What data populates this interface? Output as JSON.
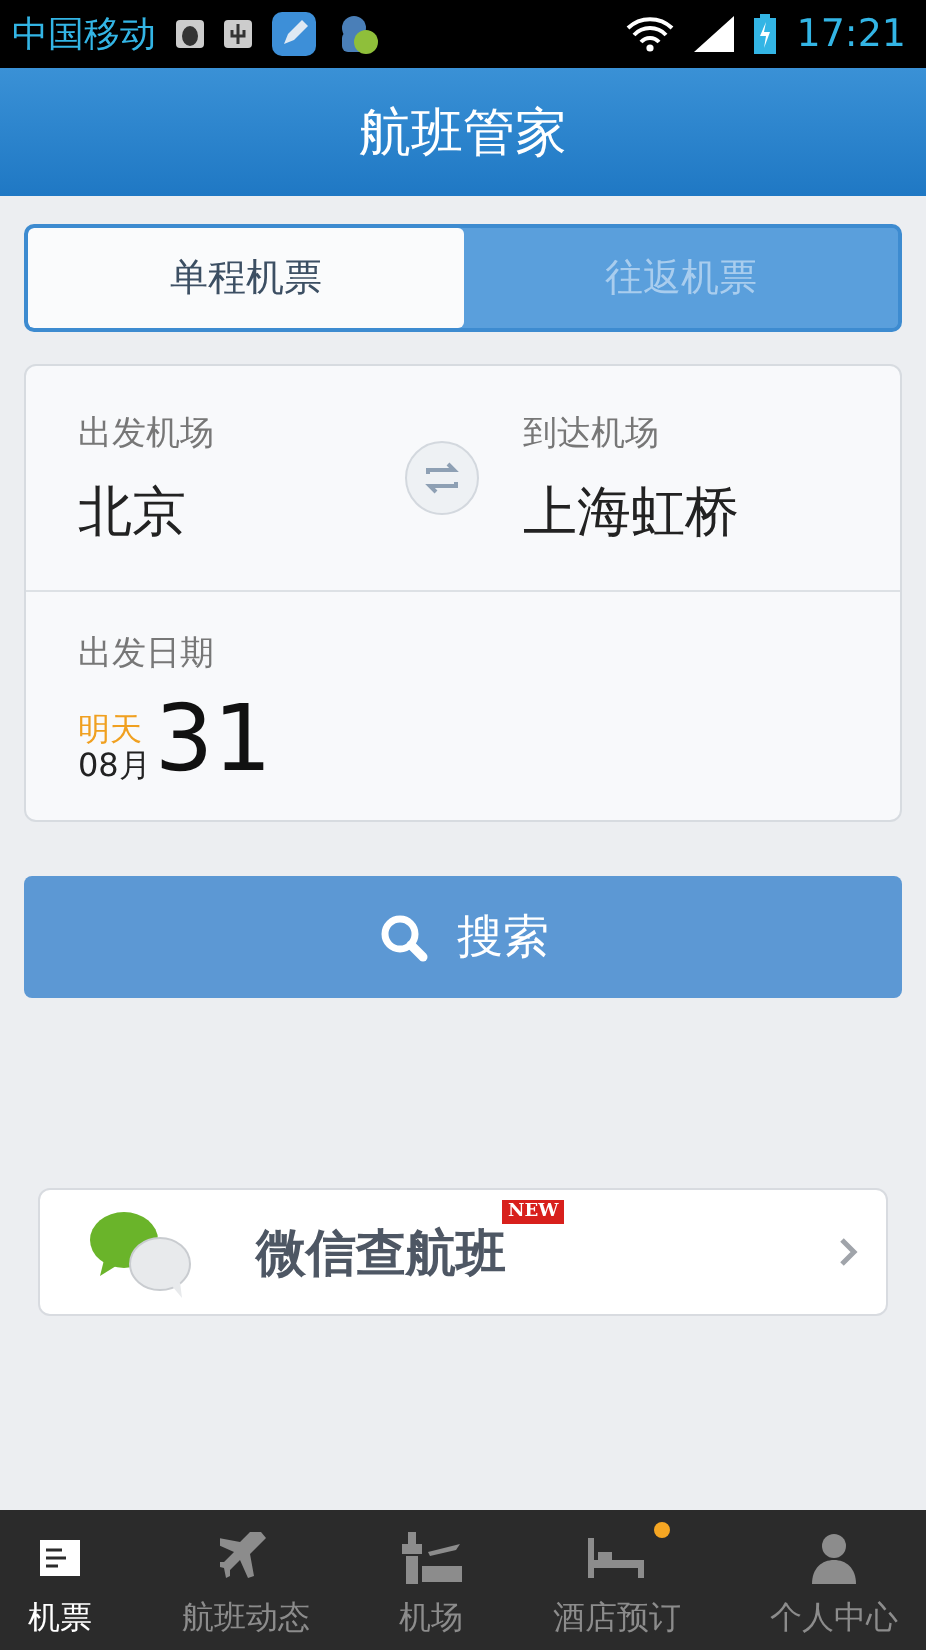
{
  "status_bar": {
    "carrier": "中国移动",
    "time": "17:21"
  },
  "header": {
    "title": "航班管家"
  },
  "trip_tabs": [
    {
      "label": "单程机票",
      "selected": true
    },
    {
      "label": "往返机票",
      "selected": false
    }
  ],
  "route": {
    "from_label": "出发机场",
    "from_value": "北京",
    "to_label": "到达机场",
    "to_value": "上海虹桥"
  },
  "date": {
    "label": "出发日期",
    "relative": "明天",
    "month": "08月",
    "day": "31"
  },
  "search_button": "搜索",
  "wechat_card": {
    "title": "微信查航班",
    "badge": "NEW"
  },
  "bottom_nav": [
    {
      "kind": "ticket",
      "label": "机票",
      "selected": true,
      "dot": false
    },
    {
      "kind": "plane",
      "label": "航班动态",
      "selected": false,
      "dot": false
    },
    {
      "kind": "tower",
      "label": "机场",
      "selected": false,
      "dot": false
    },
    {
      "kind": "bed",
      "label": "酒店预订",
      "selected": false,
      "dot": true
    },
    {
      "kind": "person",
      "label": "个人中心",
      "selected": false,
      "dot": false
    }
  ]
}
